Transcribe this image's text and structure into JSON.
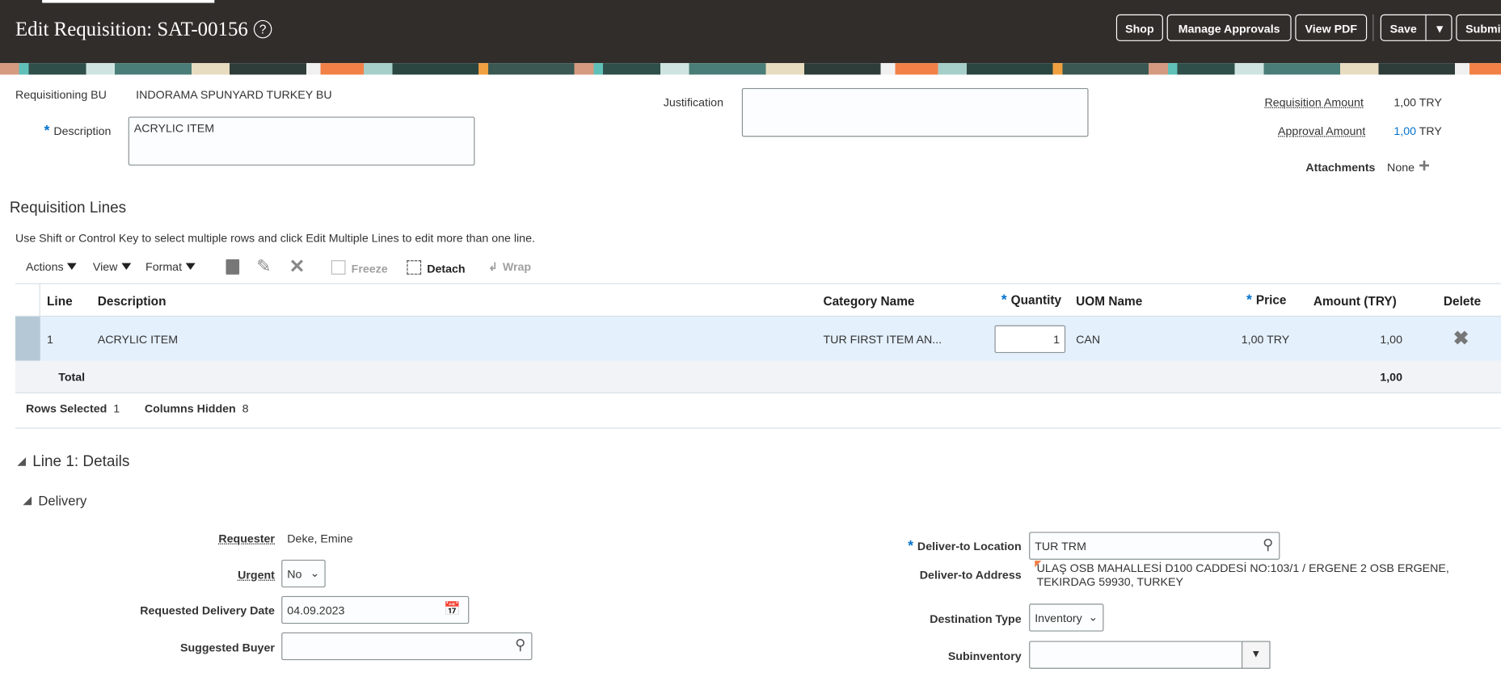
{
  "header": {
    "title": "Edit Requisition: SAT-00156",
    "help_icon": "?",
    "buttons": {
      "shop": "Shop",
      "manage_approvals": "Manage Approvals",
      "view_pdf": "View PDF",
      "save": "Save",
      "submit": "Submit"
    }
  },
  "form": {
    "requisitioning_bu_label": "Requisitioning BU",
    "requisitioning_bu": "INDORAMA SPUNYARD TURKEY BU",
    "description_label": "Description",
    "description": "ACRYLIC ITEM",
    "justification_label": "Justification",
    "justification": "",
    "requisition_amount_label": "Requisition Amount",
    "requisition_amount": "1,00",
    "requisition_currency": "TRY",
    "approval_amount_label": "Approval Amount",
    "approval_amount": "1,00",
    "approval_currency": "TRY",
    "attachments_label": "Attachments",
    "attachments": "None"
  },
  "lines": {
    "title": "Requisition Lines",
    "hint": "Use Shift or Control Key to select multiple rows and click Edit Multiple Lines to edit more than one line.",
    "toolbar": {
      "actions": "Actions",
      "view": "View",
      "format": "Format",
      "freeze": "Freeze",
      "detach": "Detach",
      "wrap": "Wrap"
    },
    "columns": {
      "line": "Line",
      "description": "Description",
      "category": "Category Name",
      "quantity": "Quantity",
      "uom": "UOM Name",
      "price": "Price",
      "amount": "Amount (TRY)",
      "delete": "Delete"
    },
    "rows": [
      {
        "line": "1",
        "description": "ACRYLIC ITEM",
        "category": "TUR FIRST ITEM AN...",
        "quantity": "1",
        "uom": "CAN",
        "price": "1,00 TRY",
        "amount": "1,00"
      }
    ],
    "total_label": "Total",
    "total": "1,00",
    "rows_selected_label": "Rows Selected",
    "rows_selected": "1",
    "columns_hidden_label": "Columns Hidden",
    "columns_hidden": "8"
  },
  "details": {
    "title": "Line 1: Details",
    "delivery_title": "Delivery",
    "requester_label": "Requester",
    "requester": "Deke, Emine",
    "urgent_label": "Urgent",
    "urgent": "No",
    "requested_date_label": "Requested Delivery Date",
    "requested_date": "04.09.2023",
    "suggested_buyer_label": "Suggested Buyer",
    "suggested_buyer": "",
    "deliver_to_location_label": "Deliver-to Location",
    "deliver_to_location": "TUR TRM",
    "deliver_to_address_label": "Deliver-to Address",
    "deliver_to_address_1": "ULAŞ OSB MAHALLESİ D100 CADDESİ NO:103/1 / ERGENE 2 OSB ERGENE,",
    "deliver_to_address_2": "TEKIRDAG 59930, TURKEY",
    "destination_type_label": "Destination Type",
    "destination_type": "Inventory",
    "subinventory_label": "Subinventory",
    "subinventory": ""
  }
}
